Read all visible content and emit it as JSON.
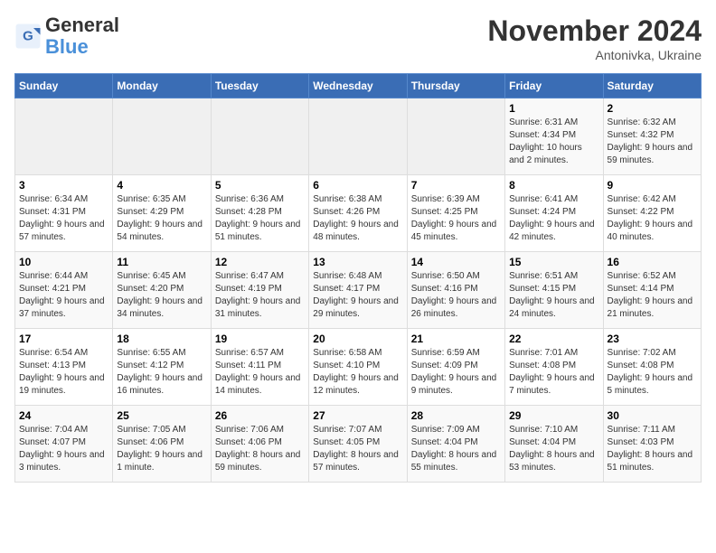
{
  "header": {
    "logo_general": "General",
    "logo_blue": "Blue",
    "month_title": "November 2024",
    "subtitle": "Antonivka, Ukraine"
  },
  "weekdays": [
    "Sunday",
    "Monday",
    "Tuesday",
    "Wednesday",
    "Thursday",
    "Friday",
    "Saturday"
  ],
  "weeks": [
    [
      {
        "day": "",
        "info": ""
      },
      {
        "day": "",
        "info": ""
      },
      {
        "day": "",
        "info": ""
      },
      {
        "day": "",
        "info": ""
      },
      {
        "day": "",
        "info": ""
      },
      {
        "day": "1",
        "info": "Sunrise: 6:31 AM\nSunset: 4:34 PM\nDaylight: 10 hours\nand 2 minutes."
      },
      {
        "day": "2",
        "info": "Sunrise: 6:32 AM\nSunset: 4:32 PM\nDaylight: 9 hours\nand 59 minutes."
      }
    ],
    [
      {
        "day": "3",
        "info": "Sunrise: 6:34 AM\nSunset: 4:31 PM\nDaylight: 9 hours\nand 57 minutes."
      },
      {
        "day": "4",
        "info": "Sunrise: 6:35 AM\nSunset: 4:29 PM\nDaylight: 9 hours\nand 54 minutes."
      },
      {
        "day": "5",
        "info": "Sunrise: 6:36 AM\nSunset: 4:28 PM\nDaylight: 9 hours\nand 51 minutes."
      },
      {
        "day": "6",
        "info": "Sunrise: 6:38 AM\nSunset: 4:26 PM\nDaylight: 9 hours\nand 48 minutes."
      },
      {
        "day": "7",
        "info": "Sunrise: 6:39 AM\nSunset: 4:25 PM\nDaylight: 9 hours\nand 45 minutes."
      },
      {
        "day": "8",
        "info": "Sunrise: 6:41 AM\nSunset: 4:24 PM\nDaylight: 9 hours\nand 42 minutes."
      },
      {
        "day": "9",
        "info": "Sunrise: 6:42 AM\nSunset: 4:22 PM\nDaylight: 9 hours\nand 40 minutes."
      }
    ],
    [
      {
        "day": "10",
        "info": "Sunrise: 6:44 AM\nSunset: 4:21 PM\nDaylight: 9 hours\nand 37 minutes."
      },
      {
        "day": "11",
        "info": "Sunrise: 6:45 AM\nSunset: 4:20 PM\nDaylight: 9 hours\nand 34 minutes."
      },
      {
        "day": "12",
        "info": "Sunrise: 6:47 AM\nSunset: 4:19 PM\nDaylight: 9 hours\nand 31 minutes."
      },
      {
        "day": "13",
        "info": "Sunrise: 6:48 AM\nSunset: 4:17 PM\nDaylight: 9 hours\nand 29 minutes."
      },
      {
        "day": "14",
        "info": "Sunrise: 6:50 AM\nSunset: 4:16 PM\nDaylight: 9 hours\nand 26 minutes."
      },
      {
        "day": "15",
        "info": "Sunrise: 6:51 AM\nSunset: 4:15 PM\nDaylight: 9 hours\nand 24 minutes."
      },
      {
        "day": "16",
        "info": "Sunrise: 6:52 AM\nSunset: 4:14 PM\nDaylight: 9 hours\nand 21 minutes."
      }
    ],
    [
      {
        "day": "17",
        "info": "Sunrise: 6:54 AM\nSunset: 4:13 PM\nDaylight: 9 hours\nand 19 minutes."
      },
      {
        "day": "18",
        "info": "Sunrise: 6:55 AM\nSunset: 4:12 PM\nDaylight: 9 hours\nand 16 minutes."
      },
      {
        "day": "19",
        "info": "Sunrise: 6:57 AM\nSunset: 4:11 PM\nDaylight: 9 hours\nand 14 minutes."
      },
      {
        "day": "20",
        "info": "Sunrise: 6:58 AM\nSunset: 4:10 PM\nDaylight: 9 hours\nand 12 minutes."
      },
      {
        "day": "21",
        "info": "Sunrise: 6:59 AM\nSunset: 4:09 PM\nDaylight: 9 hours\nand 9 minutes."
      },
      {
        "day": "22",
        "info": "Sunrise: 7:01 AM\nSunset: 4:08 PM\nDaylight: 9 hours\nand 7 minutes."
      },
      {
        "day": "23",
        "info": "Sunrise: 7:02 AM\nSunset: 4:08 PM\nDaylight: 9 hours\nand 5 minutes."
      }
    ],
    [
      {
        "day": "24",
        "info": "Sunrise: 7:04 AM\nSunset: 4:07 PM\nDaylight: 9 hours\nand 3 minutes."
      },
      {
        "day": "25",
        "info": "Sunrise: 7:05 AM\nSunset: 4:06 PM\nDaylight: 9 hours\nand 1 minute."
      },
      {
        "day": "26",
        "info": "Sunrise: 7:06 AM\nSunset: 4:06 PM\nDaylight: 8 hours\nand 59 minutes."
      },
      {
        "day": "27",
        "info": "Sunrise: 7:07 AM\nSunset: 4:05 PM\nDaylight: 8 hours\nand 57 minutes."
      },
      {
        "day": "28",
        "info": "Sunrise: 7:09 AM\nSunset: 4:04 PM\nDaylight: 8 hours\nand 55 minutes."
      },
      {
        "day": "29",
        "info": "Sunrise: 7:10 AM\nSunset: 4:04 PM\nDaylight: 8 hours\nand 53 minutes."
      },
      {
        "day": "30",
        "info": "Sunrise: 7:11 AM\nSunset: 4:03 PM\nDaylight: 8 hours\nand 51 minutes."
      }
    ]
  ]
}
